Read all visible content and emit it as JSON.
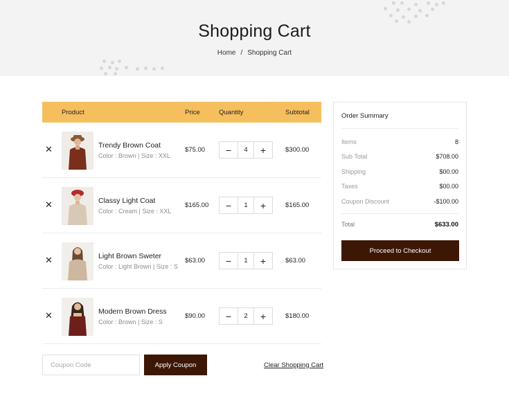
{
  "hero": {
    "title": "Shopping Cart",
    "breadcrumb": [
      "Home",
      "Shopping Cart"
    ],
    "separator": "/"
  },
  "cart": {
    "columns": [
      "Product",
      "Price",
      "Quantity",
      "Subtotal"
    ],
    "items": [
      {
        "name": "Trendy Brown Coat",
        "meta": "Color : Brown | Size : XXL",
        "price": "$75.00",
        "qty": "4",
        "subtotal": "$300.00",
        "thumb_color": "#7a2e1c"
      },
      {
        "name": "Classy Light Coat",
        "meta": "Color : Cream | Size : XXL",
        "price": "$165.00",
        "qty": "1",
        "subtotal": "$165.00",
        "thumb_color": "#c9b9a6"
      },
      {
        "name": "Light Brown Sweter",
        "meta": "Color : Light Brown | Size : S",
        "price": "$63.00",
        "qty": "1",
        "subtotal": "$63.00",
        "thumb_color": "#c8b29a"
      },
      {
        "name": "Modern Brown Dress",
        "meta": "Color :  Brown | Size : S",
        "price": "$90.00",
        "qty": "2",
        "subtotal": "$180.00",
        "thumb_color": "#6d1f1c"
      }
    ],
    "remove_symbol": "✕",
    "minus_symbol": "−",
    "plus_symbol": "+"
  },
  "coupon": {
    "placeholder": "Coupon Code",
    "apply_label": "Apply Coupon",
    "clear_label": "Clear Shopping Cart"
  },
  "summary": {
    "title": "Order Summary",
    "lines": [
      {
        "label": "Items",
        "value": "8"
      },
      {
        "label": "Sub Total",
        "value": "$708.00"
      },
      {
        "label": "Shipping",
        "value": "$00.00"
      },
      {
        "label": "Taxes",
        "value": "$00.00"
      },
      {
        "label": "Coupon Discount",
        "value": "-$100.00"
      }
    ],
    "total_label": "Total",
    "total_value": "$633.00",
    "checkout_label": "Proceed to Checkout"
  },
  "colors": {
    "header_bar": "#f5bf5e",
    "accent_dark": "#3d1705",
    "hero_bg": "#f3f3f3"
  }
}
